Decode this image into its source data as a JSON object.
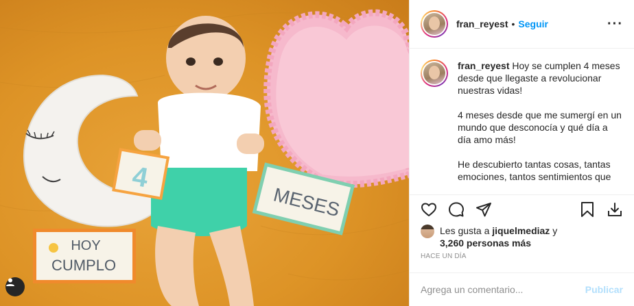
{
  "post": {
    "username": "fran_reyest",
    "follow_label": "Seguir",
    "dot": "•",
    "more_label": "···"
  },
  "photo": {
    "card_today": [
      "HOY",
      "CUMPLO"
    ],
    "card_number": "4",
    "card_months": "MESES"
  },
  "caption": {
    "username": "fran_reyest",
    "paragraphs": [
      "Hoy se cumplen 4 meses desde que llegaste a revolucionar nuestras vidas!",
      "4 meses desde que me sumergí en un mundo que desconocía y qué día a día amo más!",
      "He descubierto tantas cosas, tantas emociones, tantos sentimientos que"
    ]
  },
  "actions": {
    "like_icon": "heart-icon",
    "comment_icon": "comment-icon",
    "share_icon": "paper-plane-icon",
    "save_icon": "bookmark-icon",
    "download_icon": "download-tray-icon"
  },
  "likes": {
    "prefix": "Les gusta a ",
    "user": "jiquelmediaz",
    "connector": " y",
    "count": "3,260 personas más"
  },
  "timestamp": "Hace un día",
  "comment_box": {
    "placeholder": "Agrega un comentario...",
    "publish_label": "Publicar"
  },
  "colors": {
    "accent": "#0095f6",
    "publish_disabled": "#b2dffc",
    "blanket": "#dd9326"
  }
}
